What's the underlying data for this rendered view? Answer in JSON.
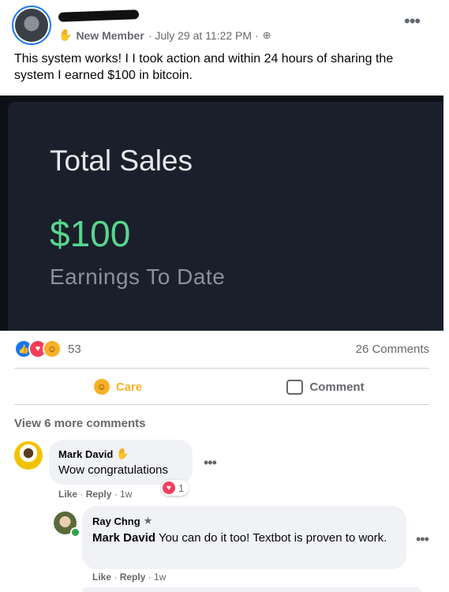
{
  "post": {
    "member_badge": "New Member",
    "timestamp": " · July 29 at 11:22 PM · ",
    "text": "This system works! I I took action and within 24 hours of sharing the system I earned $100 in bitcoin.",
    "more_icon": "more-horizontal-icon"
  },
  "image": {
    "title": "Total Sales",
    "amount": "$100",
    "subtitle": "Earnings To Date"
  },
  "stats": {
    "reaction_count": "53",
    "comments_count": "26 Comments"
  },
  "actions": {
    "care_label": "Care",
    "comment_label": "Comment"
  },
  "view_more": "View 6 more comments",
  "comments": [
    {
      "author": "Mark David",
      "text": "Wow congratulations",
      "reaction_count": "1",
      "like": "Like",
      "reply": "Reply",
      "time": "1w"
    },
    {
      "author": "Ray Chng",
      "mention": "Mark David",
      "text": " You can do it too! Textbot is proven to work.",
      "like": "Like",
      "reply": "Reply",
      "time": "1w"
    }
  ],
  "colors": {
    "accent": "#1877f2",
    "care": "#f7b125",
    "amount": "#58d68d"
  }
}
